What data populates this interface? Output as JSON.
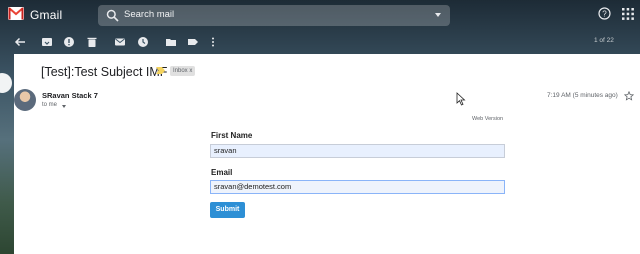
{
  "app": {
    "name": "Gmail"
  },
  "search": {
    "placeholder": "Search mail"
  },
  "toolbar": {
    "icons": [
      "back-arrow-icon",
      "archive-icon",
      "report-spam-icon",
      "delete-icon",
      "mark-unread-icon",
      "snooze-icon",
      "move-to-icon",
      "labels-icon",
      "more-vert-icon"
    ],
    "counter": "1 of 22"
  },
  "email": {
    "subject": "[Test]:Test Subject IMF",
    "label_tag": "Inbox",
    "label_tag_close": "x",
    "sender": "SRavan Stack 7",
    "to": "to me",
    "timestamp": "7:19 AM (5 minutes ago)",
    "web_version": "Web Version"
  },
  "form": {
    "first_name_label": "First Name",
    "first_name_value": "sravan",
    "email_label": "Email",
    "email_value": "sravan@demotest.com",
    "submit_label": "Submit"
  },
  "colors": {
    "header_text": "#ffffff",
    "gmail_red": "#ea4335",
    "submit_bg": "#2d8fd5",
    "input_bg": "#e8f0fe",
    "label_yellow": "#f4d35e"
  }
}
